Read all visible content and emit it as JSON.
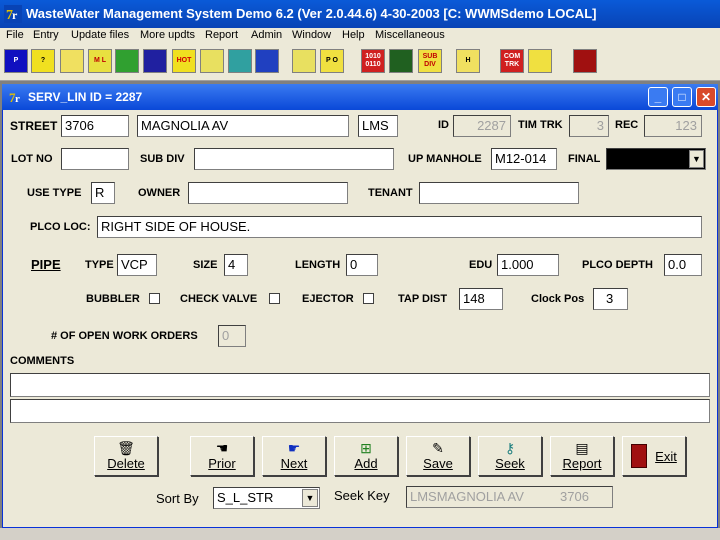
{
  "app": {
    "title": "WasteWater Management System Demo 6.2  (Ver 2.0.44.6)   4-30-2003   [C:  WWMSdemo  LOCAL]"
  },
  "menu": [
    "File",
    "Entry",
    "Update files",
    "More updts",
    "Report",
    "Admin",
    "Window",
    "Help",
    "Miscellaneous"
  ],
  "toolbar": [
    {
      "icon": "p-icon",
      "text": "P",
      "bg": "#1010c0",
      "fg": "#fff"
    },
    {
      "icon": "search-icon",
      "text": "?",
      "bg": "#f0e020",
      "fg": "#000"
    },
    {
      "icon": "printer-icon",
      "text": "",
      "bg": "#f0e060",
      "fg": "#000"
    },
    {
      "icon": "ml-icon",
      "text": "M L",
      "bg": "#e8e040",
      "fg": "#c00000"
    },
    {
      "icon": "house-icon",
      "text": "",
      "bg": "#30a030",
      "fg": "#fff"
    },
    {
      "icon": "map-icon",
      "text": "",
      "bg": "#2020a0",
      "fg": "#fff"
    },
    {
      "icon": "hot-icon",
      "text": "HOT",
      "bg": "#f0e020",
      "fg": "#d00000"
    },
    {
      "icon": "camera-icon",
      "text": "",
      "bg": "#e8e060",
      "fg": "#000"
    },
    {
      "icon": "building-icon",
      "text": "",
      "bg": "#30a0a0",
      "fg": "#fff"
    },
    {
      "icon": "lightbulb-icon",
      "text": "",
      "bg": "#2040c0",
      "fg": "#ff0"
    },
    {
      "icon": "tool-icon",
      "text": "",
      "bg": "#e8e060",
      "fg": "#000"
    },
    {
      "icon": "po-icon",
      "text": "P O",
      "bg": "#f0e040",
      "fg": "#000"
    },
    {
      "icon": "binary-icon",
      "text": "1010 0110",
      "bg": "#d02020",
      "fg": "#fff"
    },
    {
      "icon": "chart-icon",
      "text": "",
      "bg": "#206020",
      "fg": "#fff"
    },
    {
      "icon": "subdiv-icon",
      "text": "SUB DIV",
      "bg": "#f0e040",
      "fg": "#c00000"
    },
    {
      "icon": "manhole-icon",
      "text": "H",
      "bg": "#f0e060",
      "fg": "#000"
    },
    {
      "icon": "comtrk-icon",
      "text": "COM TRK",
      "bg": "#d02020",
      "fg": "#fff"
    },
    {
      "icon": "transfer-icon",
      "text": "",
      "bg": "#f0e040",
      "fg": "#c00000"
    },
    {
      "icon": "exit-door-icon",
      "text": "",
      "bg": "#a01010",
      "fg": "#fff"
    }
  ],
  "window": {
    "title": "SERV_LIN ID =      2287",
    "minimize": "_",
    "maximize": "□",
    "close": "✕"
  },
  "form": {
    "street_label": "STREET",
    "street_no": "3706",
    "street_name": "MAGNOLIA AV",
    "street_code": "LMS",
    "id_label": "ID",
    "id_value": "2287",
    "timtrk_label": "TIM TRK",
    "timtrk_value": "3",
    "rec_label": "REC",
    "rec_value": "123",
    "lotno_label": "LOT NO",
    "lotno_value": "",
    "subdiv_label": "SUB DIV",
    "subdiv_value": "",
    "upmanhole_label": "UP MANHOLE",
    "upmanhole_value": "M12-014",
    "final_label": "FINAL",
    "final_value": "",
    "usetype_label": "USE TYPE",
    "usetype_value": "R",
    "owner_label": "OWNER",
    "owner_value": "",
    "tenant_label": "TENANT",
    "tenant_value": "",
    "plcoloc_label": "PLCO LOC:",
    "plcoloc_value": "RIGHT SIDE OF HOUSE.",
    "pipe_label": "PIPE",
    "type_label": "TYPE",
    "type_value": "VCP",
    "size_label": "SIZE",
    "size_value": "4",
    "length_label": "LENGTH",
    "length_value": "0",
    "edu_label": "EDU",
    "edu_value": "1.000",
    "plcodepth_label": "PLCO DEPTH",
    "plcodepth_value": "0.0",
    "bubbler_label": "BUBBLER",
    "checkvalve_label": "CHECK VALVE",
    "ejector_label": "EJECTOR",
    "tapdist_label": "TAP DIST",
    "tapdist_value": "148",
    "clockpos_label": "Clock Pos",
    "clockpos_value": "3",
    "openwo_label": "# OF OPEN WORK ORDERS",
    "openwo_value": "0",
    "comments_label": "COMMENTS",
    "comment1": "",
    "comment2": ""
  },
  "buttons": {
    "delete": "Delete",
    "prior": "Prior",
    "next": "Next",
    "add": "Add",
    "save": "Save",
    "seek": "Seek",
    "report": "Report",
    "exit": "Exit"
  },
  "sort": {
    "label": "Sort By",
    "value": "S_L_STR"
  },
  "seekkey": {
    "label": "Seek Key",
    "value": "LMSMAGNOLIA AV          3706"
  }
}
